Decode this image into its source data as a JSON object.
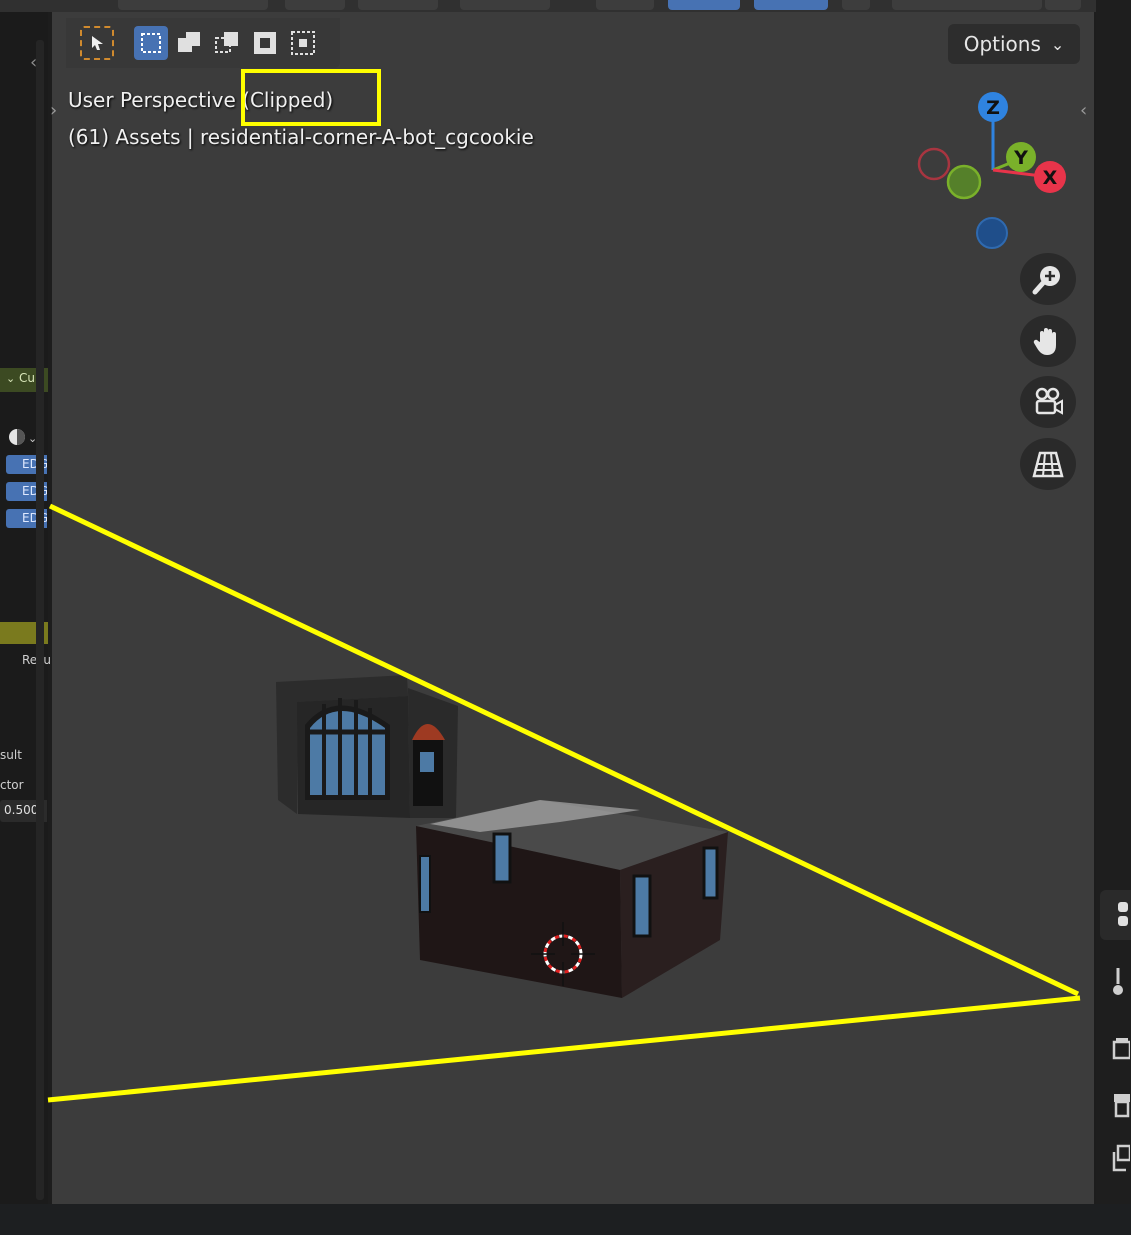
{
  "viewport": {
    "title": "User Perspective",
    "clip_status": "(Clipped)",
    "collection_info": "(61) Assets | residential-corner-A-bot_cgcookie"
  },
  "header": {
    "options_label": "Options"
  },
  "left_panel": {
    "node_header": "Cub",
    "edge_items": [
      "EDG",
      "EDG",
      "EDG"
    ],
    "result_label": "Resu",
    "labels": [
      "sult",
      "ctor"
    ],
    "factor_value": "0.500"
  },
  "gizmo": {
    "z": "Z",
    "y": "Y",
    "x": "X"
  },
  "icons": {
    "select_tool": "cursor-arrow-icon",
    "select_box": "select-box-icon",
    "zoom": "zoom-in-icon",
    "pan": "hand-pan-icon",
    "camera": "camera-view-icon",
    "ortho": "ortho-grid-icon",
    "cursor": "3d-cursor-icon"
  },
  "colors": {
    "viewport_bg": "#3c3c3c",
    "highlight_yellow": "#ffff00",
    "accent_blue": "#4772b3",
    "axis_x": "#e8344a",
    "axis_y": "#7ab12a",
    "axis_z": "#2f83e0"
  }
}
